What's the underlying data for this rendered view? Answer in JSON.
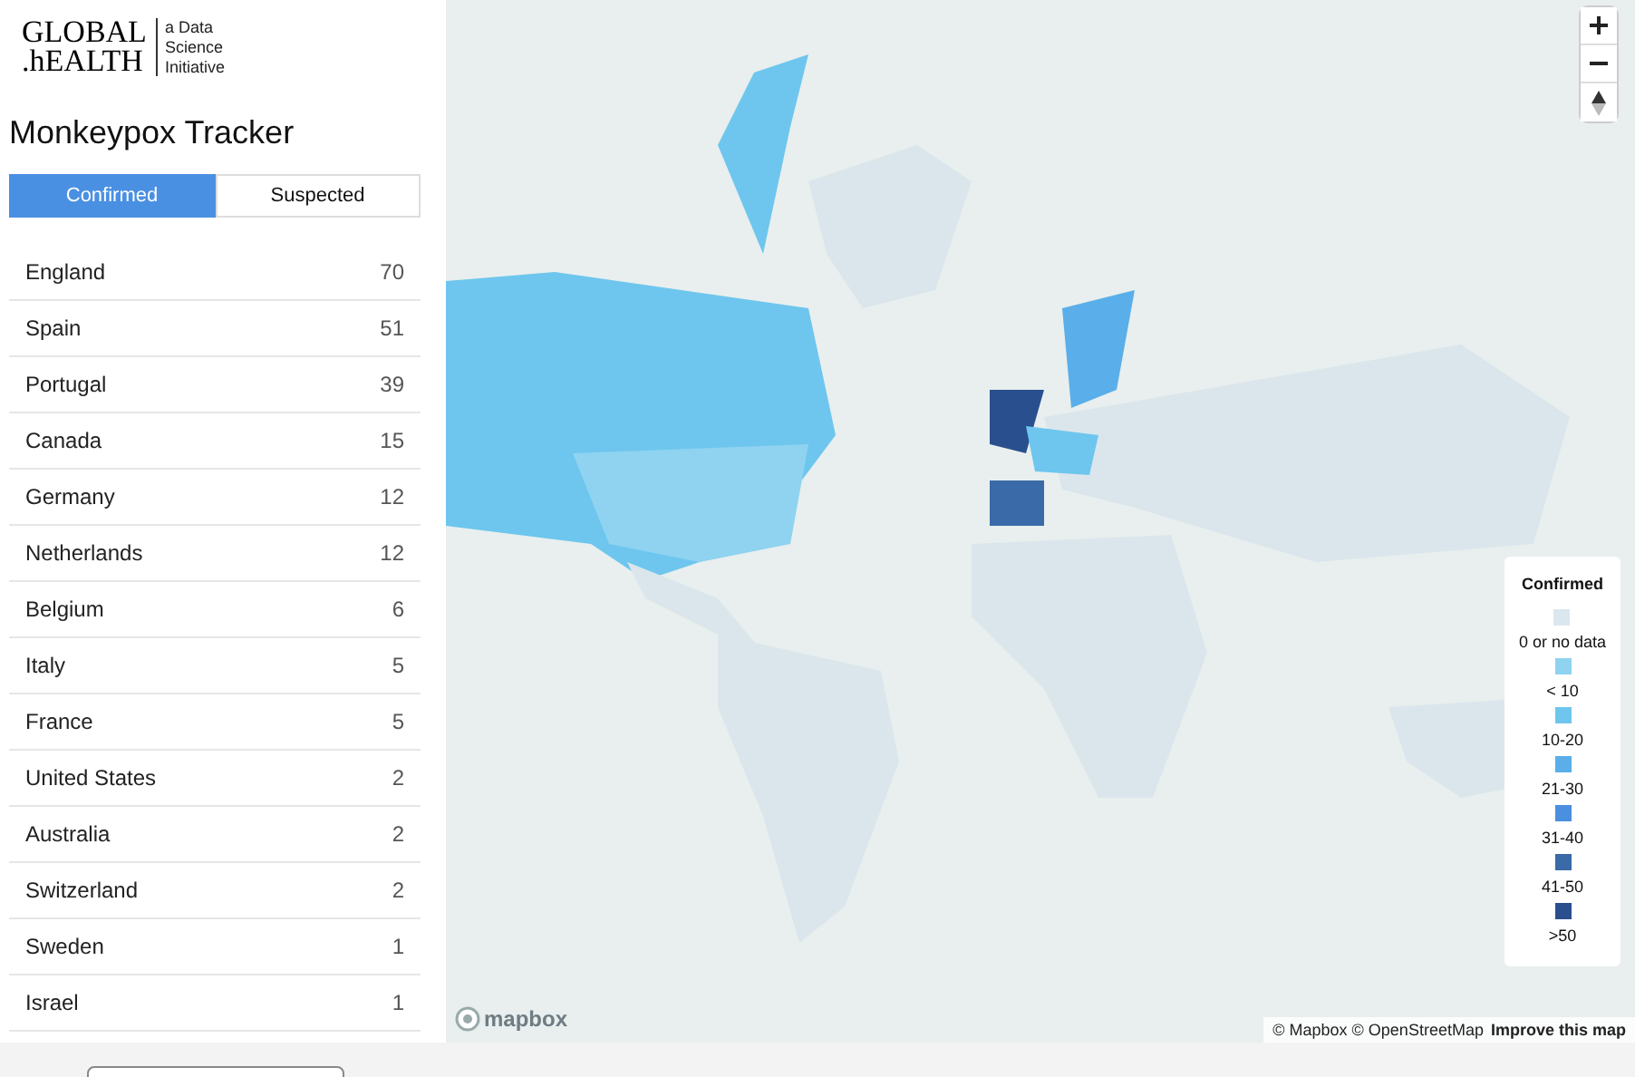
{
  "logo": {
    "line_1": "GLOBAL",
    "line_2": ".hEALTH",
    "tagline": "a Data Science Initiative"
  },
  "title": "Monkeypox Tracker",
  "tabs": [
    {
      "label": "Confirmed",
      "selected": true
    },
    {
      "label": "Suspected",
      "selected": false
    }
  ],
  "countries": [
    {
      "name": "England",
      "count": "70"
    },
    {
      "name": "Spain",
      "count": "51"
    },
    {
      "name": "Portugal",
      "count": "39"
    },
    {
      "name": "Canada",
      "count": "15"
    },
    {
      "name": "Germany",
      "count": "12"
    },
    {
      "name": "Netherlands",
      "count": "12"
    },
    {
      "name": "Belgium",
      "count": "6"
    },
    {
      "name": "Italy",
      "count": "5"
    },
    {
      "name": "France",
      "count": "5"
    },
    {
      "name": "United States",
      "count": "2"
    },
    {
      "name": "Australia",
      "count": "2"
    },
    {
      "name": "Switzerland",
      "count": "2"
    },
    {
      "name": "Sweden",
      "count": "1"
    },
    {
      "name": "Israel",
      "count": "1"
    }
  ],
  "map_controls": [
    {
      "kind": "zoom_in"
    },
    {
      "kind": "zoom_out"
    },
    {
      "kind": "compass"
    }
  ],
  "legend": {
    "title": "Confirmed",
    "items": [
      {
        "label": "0 or no data",
        "color": "#dbe7ee"
      },
      {
        "label": "< 10",
        "color": "#8fd3f0"
      },
      {
        "label": "10-20",
        "color": "#6ec6ee"
      },
      {
        "label": "21-30",
        "color": "#5aaee9"
      },
      {
        "label": "31-40",
        "color": "#4a8fe0"
      },
      {
        "label": "41-50",
        "color": "#3a6aa8"
      },
      {
        "label": ">50",
        "color": "#2a4f8e"
      }
    ]
  },
  "map_logo": "mapbox",
  "attribution": {
    "text": "© Mapbox © OpenStreetMap",
    "link": "Improve this map"
  }
}
